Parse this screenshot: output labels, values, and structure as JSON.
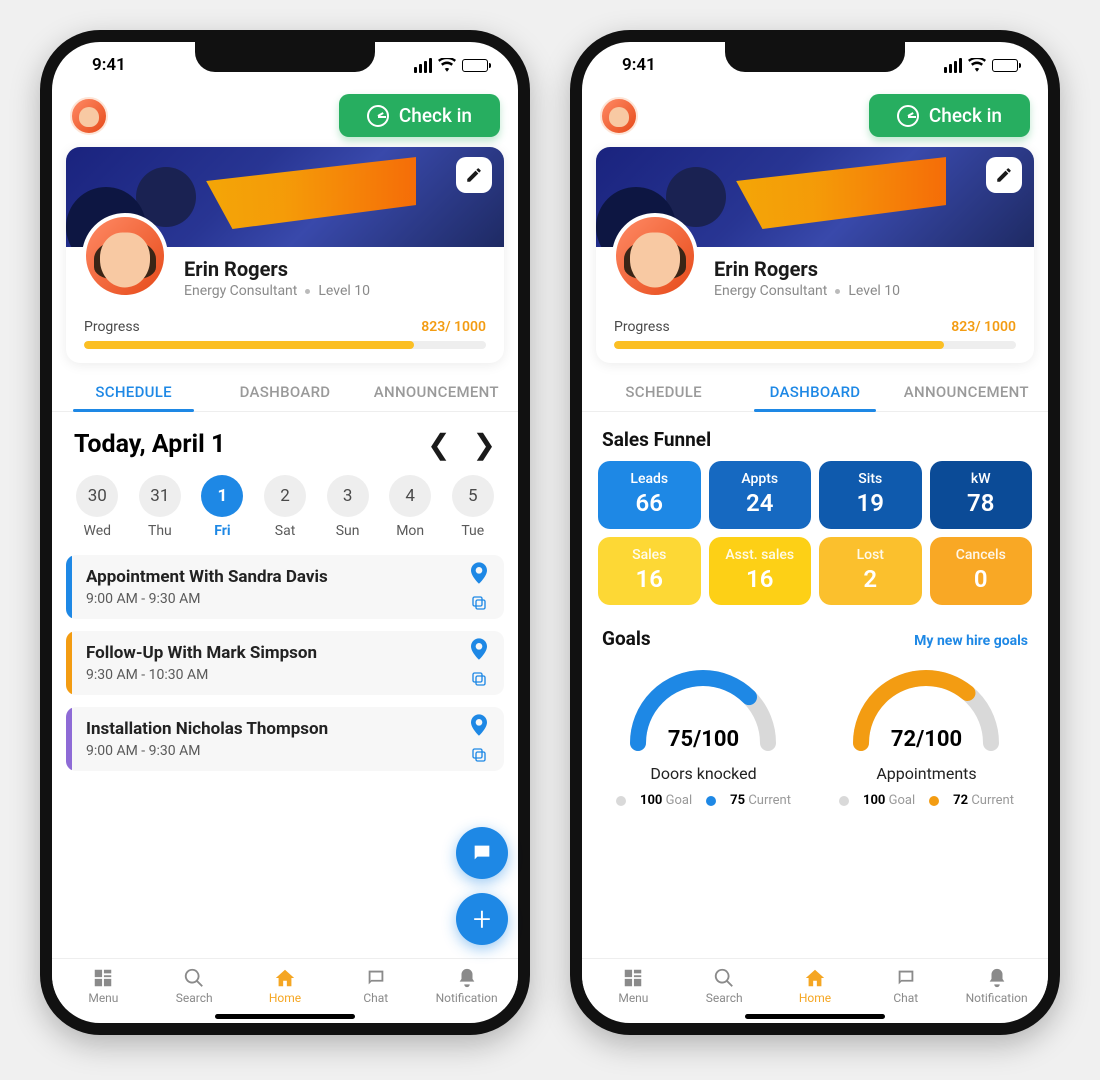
{
  "status": {
    "time": "9:41"
  },
  "header": {
    "checkin_label": "Check in"
  },
  "profile": {
    "name": "Erin Rogers",
    "role": "Energy Consultant",
    "level": "Level 10",
    "progress_label": "Progress",
    "progress_value": "823/ 1000",
    "progress_pct": 82
  },
  "tabs": {
    "schedule": "SCHEDULE",
    "dashboard": "DASHBOARD",
    "announcement": "ANNOUNCEMENT"
  },
  "schedule": {
    "date_title": "Today,  April 1",
    "days": [
      {
        "num": "30",
        "label": "Wed"
      },
      {
        "num": "31",
        "label": "Thu"
      },
      {
        "num": "1",
        "label": "Fri",
        "active": true
      },
      {
        "num": "2",
        "label": "Sat"
      },
      {
        "num": "3",
        "label": "Sun"
      },
      {
        "num": "4",
        "label": "Mon"
      },
      {
        "num": "5",
        "label": "Tue"
      }
    ],
    "appointments": [
      {
        "title": "Appointment With Sandra Davis",
        "time": "9:00 AM - 9:30 AM",
        "color": "#1e88e5"
      },
      {
        "title": "Follow-Up With Mark Simpson",
        "time": "9:30  AM - 10:30 AM",
        "color": "#f39c12"
      },
      {
        "title": "Installation Nicholas Thompson",
        "time": "9:00 AM - 9:30 AM",
        "color": "#8e6bd6"
      }
    ]
  },
  "dashboard": {
    "sales_funnel_title": "Sales Funnel",
    "funnel_top": [
      {
        "label": "Leads",
        "value": "66"
      },
      {
        "label": "Appts",
        "value": "24"
      },
      {
        "label": "Sits",
        "value": "19"
      },
      {
        "label": "kW",
        "value": "78"
      }
    ],
    "funnel_bottom": [
      {
        "label": "Sales",
        "value": "16"
      },
      {
        "label": "Asst. sales",
        "value": "16"
      },
      {
        "label": "Lost",
        "value": "2"
      },
      {
        "label": "Cancels",
        "value": "0"
      }
    ],
    "goals_title": "Goals",
    "goals_link": "My new hire goals",
    "gauges": [
      {
        "value": "75/100",
        "label": "Doors knocked",
        "pct": 75,
        "color": "#1e88e5",
        "goal": "100",
        "current": "75"
      },
      {
        "value": "72/100",
        "label": "Appointments",
        "pct": 72,
        "color": "#f39c12",
        "goal": "100",
        "current": "72"
      }
    ],
    "legend_goal": "Goal",
    "legend_current": "Current"
  },
  "nav": {
    "menu": "Menu",
    "search": "Search",
    "home": "Home",
    "chat": "Chat",
    "notification": "Notification"
  }
}
